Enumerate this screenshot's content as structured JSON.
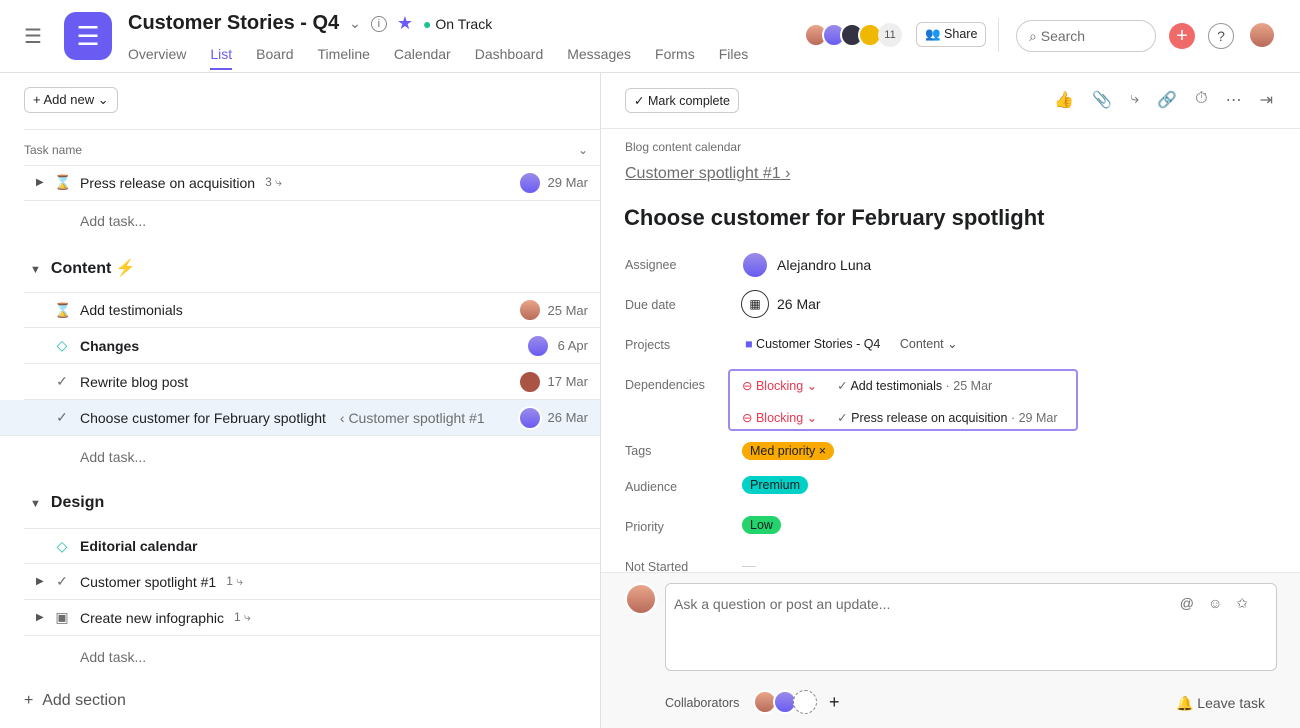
{
  "header": {
    "title": "Customer Stories - Q4",
    "status": "On Track",
    "tabs": [
      "Overview",
      "List",
      "Board",
      "Timeline",
      "Calendar",
      "Dashboard",
      "Messages",
      "Forms",
      "Files"
    ],
    "active_tab": "List",
    "member_count": "11",
    "share": "Share",
    "search_placeholder": "Search"
  },
  "list": {
    "add_new": "Add new",
    "column_task_name": "Task name",
    "add_task": "Add task...",
    "add_section": "Add section",
    "top_task": {
      "name": "Press release on acquisition",
      "subtasks": "3",
      "date": "29 Mar"
    },
    "sections": [
      {
        "name": "Content",
        "emoji": "⚡",
        "tasks": [
          {
            "name": "Add testimonials",
            "date": "25 Mar",
            "icon": "hourglass-icon"
          },
          {
            "name": "Changes",
            "date": "6 Apr",
            "icon": "milestone-icon",
            "bold": true
          },
          {
            "name": "Rewrite blog post",
            "date": "17 Mar",
            "icon": "check-circle-icon"
          },
          {
            "name": "Choose customer for February spotlight",
            "parent": "‹ Customer spotlight #1",
            "date": "26 Mar",
            "icon": "check-circle-icon",
            "selected": true
          }
        ]
      },
      {
        "name": "Design",
        "tasks": [
          {
            "name": "Editorial calendar",
            "icon": "milestone-icon",
            "bold": true
          },
          {
            "name": "Customer spotlight #1",
            "subtasks": "1",
            "icon": "check-circle-icon"
          },
          {
            "name": "Create new infographic",
            "subtasks": "1",
            "icon": "approval-icon"
          }
        ]
      }
    ]
  },
  "detail": {
    "mark_complete": "Mark complete",
    "project_context": "Blog content calendar",
    "parent": "Customer spotlight #1",
    "title": "Choose customer for February spotlight",
    "fields": {
      "assignee_label": "Assignee",
      "assignee": "Alejandro Luna",
      "due_label": "Due date",
      "due": "26 Mar",
      "projects_label": "Projects",
      "project": "Customer Stories - Q4",
      "section": "Content",
      "deps_label": "Dependencies",
      "deps": [
        {
          "type": "Blocking",
          "task": "Add testimonials",
          "date": "· 25 Mar"
        },
        {
          "type": "Blocking",
          "task": "Press release on acquisition",
          "date": "· 29 Mar"
        }
      ],
      "tags_label": "Tags",
      "tag": "Med priority",
      "audience_label": "Audience",
      "audience": "Premium",
      "priority_label": "Priority",
      "priority": "Low",
      "not_started_label": "Not Started",
      "not_started": "—"
    },
    "comment_placeholder": "Ask a question or post an update...",
    "collaborators": "Collaborators",
    "leave_task": "Leave task"
  },
  "colors": {
    "accent": "#6a5cf2",
    "on_track": "#1fbf94",
    "blocking": "#e8384f",
    "med_priority": "#f9aa00",
    "premium": "#00d1c7",
    "low": "#22d46b"
  }
}
